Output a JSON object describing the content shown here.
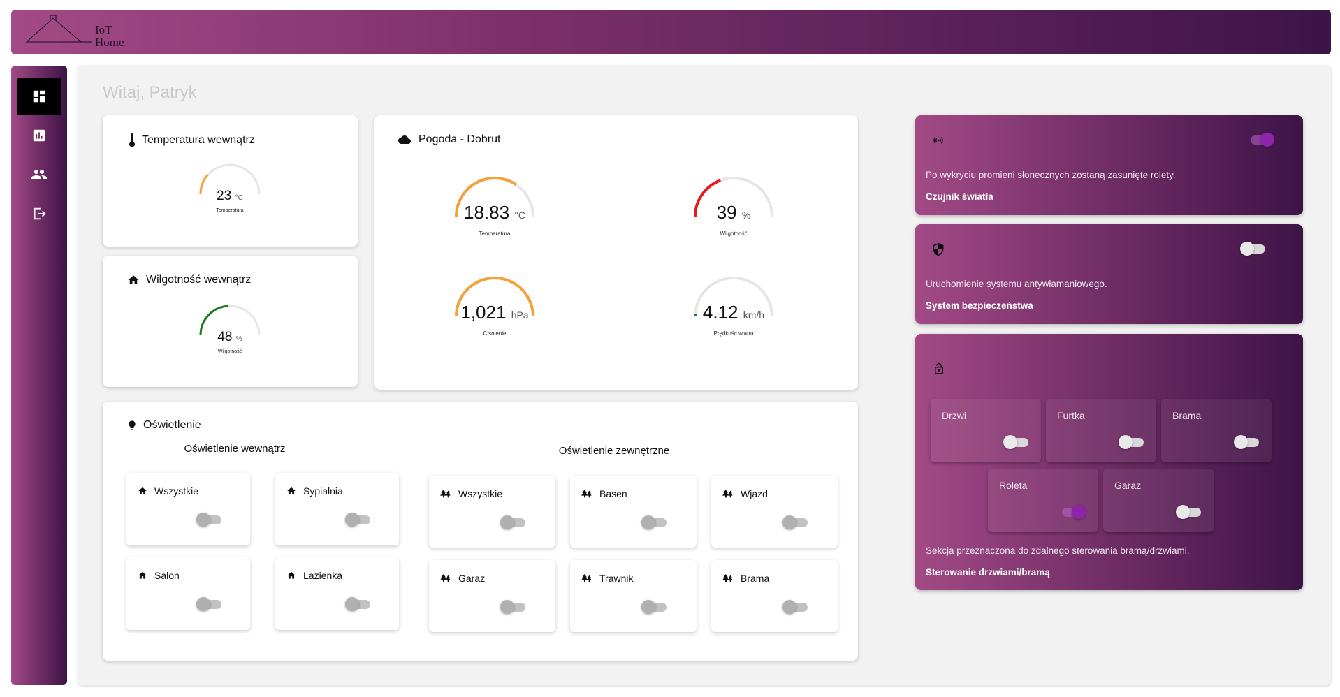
{
  "header": {
    "logo_line1": "IoT",
    "logo_line2": "Home"
  },
  "sidebar": {
    "items": [
      {
        "name": "dashboard",
        "icon": "dashboard-icon",
        "active": true
      },
      {
        "name": "stats",
        "icon": "bar-chart-icon",
        "active": false
      },
      {
        "name": "users",
        "icon": "people-icon",
        "active": false
      },
      {
        "name": "logout",
        "icon": "logout-icon",
        "active": false
      }
    ]
  },
  "greeting": "Witaj, Patryk",
  "indoor_temp": {
    "title": "Temperatura wewnątrz",
    "value": "23",
    "unit": "°C",
    "label": "Temperatura",
    "fraction": 0.23,
    "color": "#f5a13a"
  },
  "indoor_humidity": {
    "title": "Wilgotność wewnątrz",
    "value": "48",
    "unit": "%",
    "label": "Wilgotność",
    "fraction": 0.48,
    "color": "#1f7a1f"
  },
  "weather": {
    "title": "Pogoda - Dobrut",
    "gauges": [
      {
        "value": "18.83",
        "unit": "°C",
        "label": "Temperatura",
        "fraction": 0.69,
        "color": "#f5a13a"
      },
      {
        "value": "39",
        "unit": "%",
        "label": "Wilgotność",
        "fraction": 0.39,
        "color": "#e31b1b"
      },
      {
        "value": "1,021",
        "unit": "hPa",
        "label": "Ciśnienie",
        "fraction": 1.0,
        "color": "#f5a13a"
      },
      {
        "value": "4.12",
        "unit": "km/h",
        "label": "Prędkość wiatru",
        "fraction": 0.02,
        "color": "#1f7a1f"
      }
    ]
  },
  "lighting": {
    "title": "Oświetlenie",
    "inside_title": "Oświetlenie wewnątrz",
    "outside_title": "Oświetlenie zewnętrzne",
    "inside": [
      {
        "label": "Wszystkie",
        "on": false
      },
      {
        "label": "Sypialnia",
        "on": false
      },
      {
        "label": "Salon",
        "on": false
      },
      {
        "label": "Lazienka",
        "on": false
      }
    ],
    "outside": [
      {
        "label": "Wszystkie",
        "on": false
      },
      {
        "label": "Basen",
        "on": false
      },
      {
        "label": "Wjazd",
        "on": false
      },
      {
        "label": "Garaz",
        "on": false
      },
      {
        "label": "Trawnik",
        "on": false
      },
      {
        "label": "Brama",
        "on": false
      }
    ]
  },
  "light_sensor": {
    "desc": "Po wykryciu promieni słonecznych zostaną zasunięte rolety.",
    "name": "Czujnik światła",
    "on": true
  },
  "security": {
    "desc": "Uruchomienie systemu antywłamaniowego.",
    "name": "System bezpieczeństwa",
    "on": false
  },
  "gates": {
    "desc": "Sekcja przeznaczona do zdalnego sterowania bramą/drzwiami.",
    "name": "Sterowanie drzwiami/bramą",
    "items": [
      {
        "label": "Drzwi",
        "on": false
      },
      {
        "label": "Furtka",
        "on": false
      },
      {
        "label": "Brama",
        "on": false
      },
      {
        "label": "Roleta",
        "on": true
      },
      {
        "label": "Garaz",
        "on": false
      }
    ]
  }
}
